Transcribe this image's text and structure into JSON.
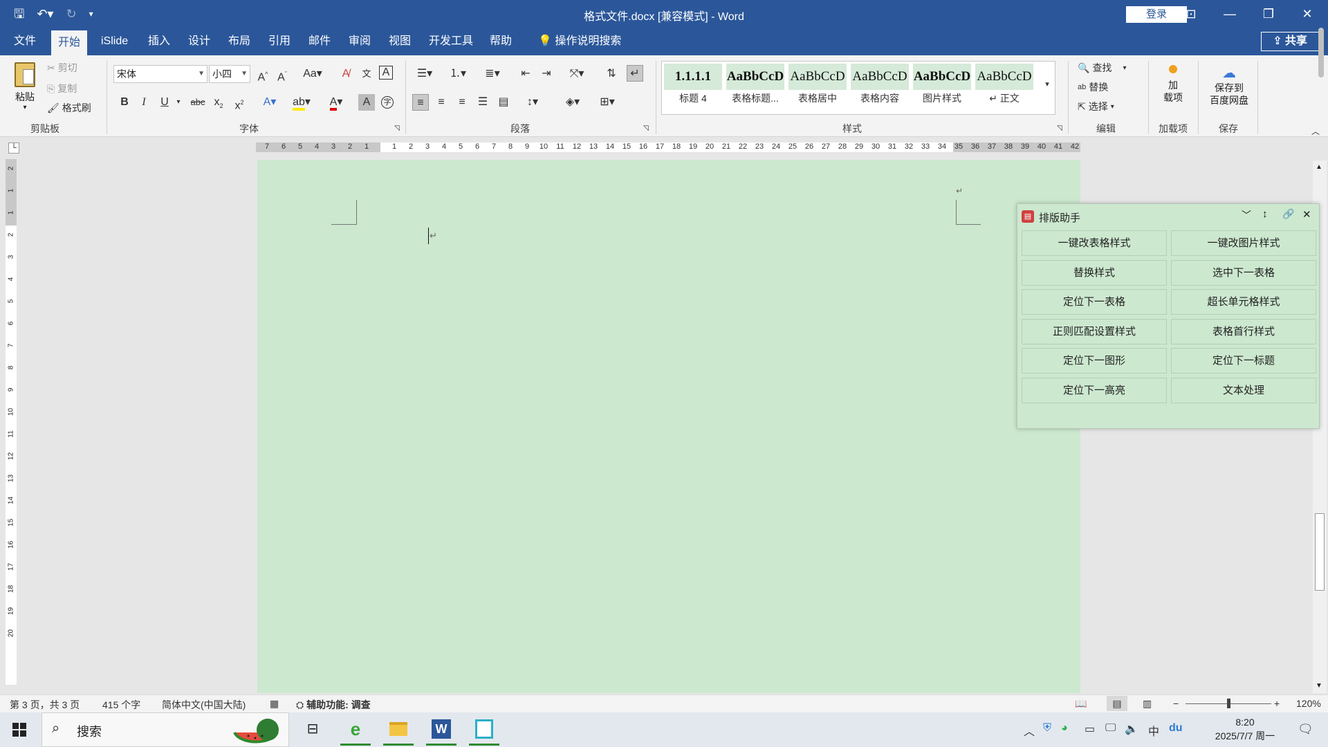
{
  "titlebar": {
    "title": "格式文件.docx [兼容模式] - Word",
    "login": "登录"
  },
  "tabs": [
    "文件",
    "开始",
    "iSlide",
    "插入",
    "设计",
    "布局",
    "引用",
    "邮件",
    "审阅",
    "视图",
    "开发工具",
    "帮助"
  ],
  "tell_me": "操作说明搜索",
  "share": "共享",
  "clipboard": {
    "paste": "粘贴",
    "cut": "剪切",
    "copy": "复制",
    "format_painter": "格式刷",
    "label": "剪贴板"
  },
  "font": {
    "name": "宋体",
    "size": "小四",
    "label": "字体"
  },
  "paragraph": {
    "label": "段落"
  },
  "styles": {
    "label": "样式",
    "items": [
      {
        "sample": "1.1.1.1",
        "name": "标题 4"
      },
      {
        "sample": "AaBbCcD",
        "name": "表格标题..."
      },
      {
        "sample": "AaBbCcD",
        "name": "表格居中"
      },
      {
        "sample": "AaBbCcD",
        "name": "表格内容"
      },
      {
        "sample": "AaBbCcD",
        "name": "图片样式"
      },
      {
        "sample": "AaBbCcD",
        "name": "↵ 正文"
      }
    ]
  },
  "editing": {
    "find": "查找",
    "replace": "替换",
    "select": "选择",
    "label": "编辑"
  },
  "addins": {
    "btn": "加\n载项",
    "label": "加载项"
  },
  "save": {
    "btn": "保存到\n百度网盘",
    "label": "保存"
  },
  "ruler": {
    "left_numbers": [
      "7",
      "6",
      "5",
      "4",
      "3",
      "2",
      "1"
    ],
    "right_numbers": [
      "1",
      "2",
      "3",
      "4",
      "5",
      "6",
      "7",
      "8",
      "9",
      "10",
      "11",
      "12",
      "13",
      "14",
      "15",
      "16",
      "17",
      "18",
      "19",
      "20",
      "21",
      "22",
      "23",
      "24",
      "25",
      "26",
      "27",
      "28",
      "29",
      "30",
      "31",
      "32",
      "33",
      "34",
      "35",
      "36",
      "37",
      "38",
      "39",
      "40",
      "41",
      "42"
    ],
    "vertical_numbers": [
      "2",
      "1",
      "1",
      "2",
      "3",
      "4",
      "5",
      "6",
      "7",
      "8",
      "9",
      "10",
      "11",
      "12",
      "13",
      "14",
      "15",
      "16",
      "17",
      "18",
      "19",
      "20"
    ]
  },
  "panel": {
    "title": "排版助手",
    "buttons": [
      "一键改表格样式",
      "一键改图片样式",
      "替换样式",
      "选中下一表格",
      "定位下一表格",
      "超长单元格样式",
      "正则匹配设置样式",
      "表格首行样式",
      "定位下一图形",
      "定位下一标题",
      "定位下一高亮",
      "文本处理"
    ]
  },
  "status": {
    "pages": "第 3 页，共 3 页",
    "words": "415 个字",
    "lang": "简体中文(中国大陆)",
    "accessibility": "辅助功能: 调查",
    "zoom": "120%"
  },
  "taskbar": {
    "search": "搜索",
    "time": "8:20",
    "date": "2025/7/7 周一",
    "ime": "中"
  },
  "colors": {
    "word_blue": "#2b579a",
    "page_green": "#cce8cf"
  }
}
